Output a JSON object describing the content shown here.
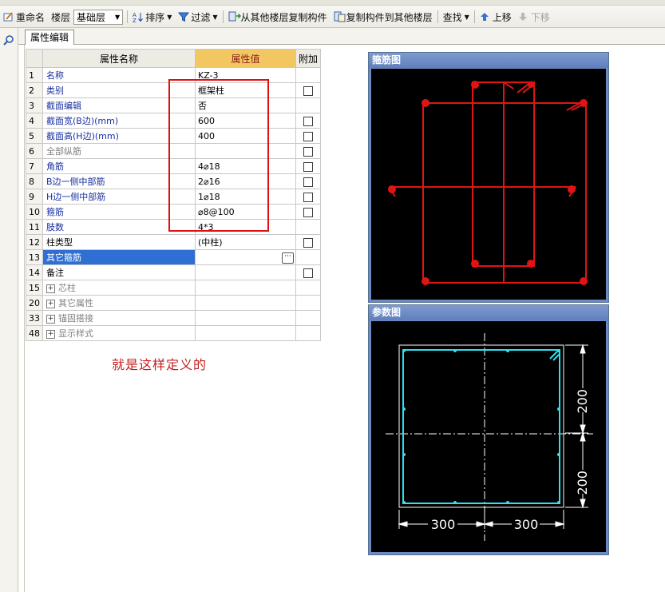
{
  "toolbar": {
    "rename": "重命名",
    "floor_label": "楼层",
    "floor_value": "基础层",
    "sort": "排序",
    "filter": "过滤",
    "copy_from": "从其他楼层复制构件",
    "copy_to": "复制构件到其他楼层",
    "find": "查找",
    "move_up": "上移",
    "move_down": "下移"
  },
  "tab": {
    "label": "属性编辑"
  },
  "grid": {
    "headers": {
      "name": "属性名称",
      "value": "属性值",
      "extra": "附加"
    },
    "rows": [
      {
        "num": "1",
        "name": "名称",
        "value": "KZ-3",
        "style": "blue",
        "check": false,
        "expand": false
      },
      {
        "num": "2",
        "name": "类别",
        "value": "框架柱",
        "style": "blue",
        "check": true,
        "expand": false
      },
      {
        "num": "3",
        "name": "截面编辑",
        "value": "否",
        "style": "blue",
        "check": false,
        "expand": false
      },
      {
        "num": "4",
        "name": "截面宽(B边)(mm)",
        "value": "600",
        "style": "blue",
        "check": true,
        "expand": false
      },
      {
        "num": "5",
        "name": "截面高(H边)(mm)",
        "value": "400",
        "style": "blue",
        "check": true,
        "expand": false
      },
      {
        "num": "6",
        "name": "全部纵筋",
        "value": "",
        "style": "gray",
        "check": true,
        "expand": false
      },
      {
        "num": "7",
        "name": "角筋",
        "value": "4⌀18",
        "style": "blue",
        "check": true,
        "expand": false
      },
      {
        "num": "8",
        "name": "B边一侧中部筋",
        "value": "2⌀16",
        "style": "blue",
        "check": true,
        "expand": false
      },
      {
        "num": "9",
        "name": "H边一侧中部筋",
        "value": "1⌀18",
        "style": "blue",
        "check": true,
        "expand": false
      },
      {
        "num": "10",
        "name": "箍筋",
        "value": "⌀8@100",
        "style": "blue",
        "check": true,
        "expand": false
      },
      {
        "num": "11",
        "name": "肢数",
        "value": "4*3",
        "style": "blue",
        "check": false,
        "expand": false
      },
      {
        "num": "12",
        "name": "柱类型",
        "value": "(中柱)",
        "style": "black",
        "check": true,
        "expand": false
      },
      {
        "num": "13",
        "name": "其它箍筋",
        "value": "",
        "style": "black",
        "check": false,
        "expand": false,
        "selected": true
      },
      {
        "num": "14",
        "name": "备注",
        "value": "",
        "style": "black",
        "check": true,
        "expand": false
      },
      {
        "num": "15",
        "name": "芯柱",
        "value": "",
        "style": "gray",
        "check": false,
        "expand": true
      },
      {
        "num": "20",
        "name": "其它属性",
        "value": "",
        "style": "gray",
        "check": false,
        "expand": true
      },
      {
        "num": "33",
        "name": "锚固搭接",
        "value": "",
        "style": "gray",
        "check": false,
        "expand": true
      },
      {
        "num": "48",
        "name": "显示样式",
        "value": "",
        "style": "gray",
        "check": false,
        "expand": true
      }
    ]
  },
  "annotation": {
    "text": "就是这样定义的"
  },
  "rebar_panel": {
    "title": "箍筋图"
  },
  "param_panel": {
    "title": "参数图",
    "dims": {
      "width_half": "300",
      "height_half": "200"
    }
  },
  "colors": {
    "rebar": "#e01414",
    "param": "#2fe0ee",
    "highlight_box": "#e01010",
    "selected_row": "#2f6fd4"
  }
}
